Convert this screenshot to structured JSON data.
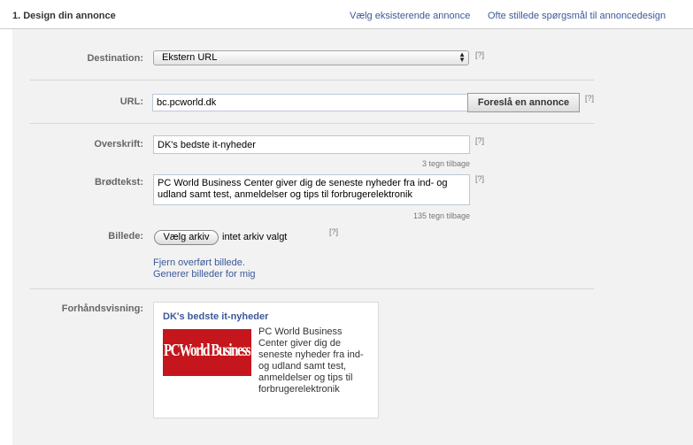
{
  "header": {
    "section_title": "1. Design din annonce",
    "link_existing": "Vælg eksisterende annonce",
    "link_faq": "Ofte stillede spørgsmål til annoncedesign"
  },
  "form": {
    "destination": {
      "label": "Destination:",
      "value": "Ekstern URL",
      "help": "[?]"
    },
    "url": {
      "label": "URL:",
      "value": "bc.pcworld.dk",
      "suggest_button": "Foreslå en annonce",
      "help": "[?]"
    },
    "headline": {
      "label": "Overskrift:",
      "value": "DK's bedste it-nyheder",
      "counter": "3 tegn tilbage",
      "help": "[?]"
    },
    "body": {
      "label": "Brødtekst:",
      "value": "PC World Business Center giver dig de seneste nyheder fra ind- og udland samt test, anmeldelser og tips til forbrugerelektronik",
      "counter": "135 tegn tilbage",
      "help": "[?]"
    },
    "image": {
      "label": "Billede:",
      "choose_button": "Vælg arkiv",
      "no_file": "intet arkiv valgt",
      "help": "[?]",
      "remove_link": "Fjern overført billede.",
      "generate_link": "Generer billeder for mig"
    },
    "preview": {
      "label": "Forhåndsvisning:",
      "title": "DK's bedste it-nyheder",
      "image_text": "PCWorld Business Center",
      "body": "PC World Business Center giver dig de seneste nyheder fra ind- og udland samt test, anmeldelser og tips til forbrugerelektronik"
    }
  },
  "colors": {
    "link": "#3b5998",
    "panel": "#f2f2f2",
    "brand_red": "#c4161c"
  }
}
